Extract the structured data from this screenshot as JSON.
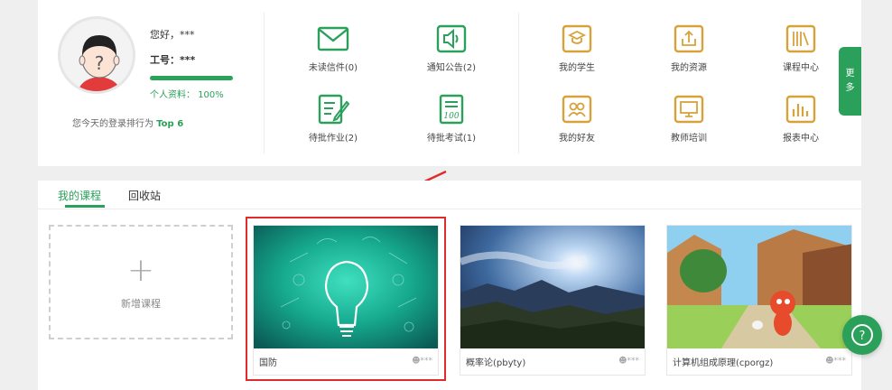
{
  "profile": {
    "greeting": "您好，***",
    "job_no": "工号：***",
    "profile_label": "个人资料：",
    "profile_percent": "100%",
    "profile_progress": 1.0,
    "rank_prefix": "您今天的登录排行为 ",
    "rank_value": "Top 6"
  },
  "messages": [
    {
      "label": "未读信件(0)",
      "icon": "envelope-icon"
    },
    {
      "label": "通知公告(2)",
      "icon": "speaker-icon"
    },
    {
      "label": "待批作业(2)",
      "icon": "homework-icon"
    },
    {
      "label": "待批考试(1)",
      "icon": "exam-icon"
    }
  ],
  "functions": [
    {
      "label": "我的学生",
      "icon": "student-icon"
    },
    {
      "label": "我的资源",
      "icon": "resource-icon"
    },
    {
      "label": "课程中心",
      "icon": "books-icon"
    },
    {
      "label": "我的好友",
      "icon": "friends-icon"
    },
    {
      "label": "教师培训",
      "icon": "training-icon"
    },
    {
      "label": "报表中心",
      "icon": "report-icon"
    }
  ],
  "more_tab": {
    "line1": "更",
    "line2": "多"
  },
  "tabs": [
    {
      "label": "我的课程",
      "active": true
    },
    {
      "label": "回收站",
      "active": false
    }
  ],
  "add_course": {
    "label": "新增课程"
  },
  "courses": [
    {
      "title": "国防",
      "owner": "***"
    },
    {
      "title": "概率论(pbyty)",
      "owner": "***"
    },
    {
      "title": "计算机组成原理(cporgz)",
      "owner": "***"
    }
  ],
  "colors": {
    "accent": "#2aa05a",
    "gold": "#d7a23a",
    "highlight": "#e02b2b"
  }
}
